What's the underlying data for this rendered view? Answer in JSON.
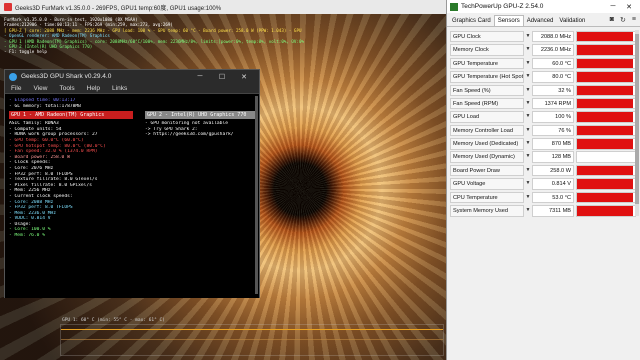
{
  "furmark": {
    "title": "Geeks3D FurMark v1.35.0.0 - 269FPS, GPU1 temp:60度, GPU1 usage:100%",
    "osd_lines": [
      {
        "text": "FurMark v1.35.0.0 - Burn-in test, 1920x1080 (8X MSAA)",
        "color": "#ffffff"
      },
      {
        "text": "Frames:212906 - time:00:13:11 - FPS:269 (min:259, max:273, avg:269)",
        "color": "#ffffff"
      },
      {
        "text": "[ GPU-Z ] core: 2088 MHz - mem: 2236 MHz - GPU load: 100 % - GPU temp: 60 °C - Board power: 258.0 W (PPW: 1.043) - GPU voltage: 0.814 V",
        "color": "#ffe14a"
      },
      {
        "text": "- OpenGL renderer: AMD Radeon(TM) Graphics",
        "color": "#7ee0ff"
      },
      {
        "text": "- GPU 1 (AMD Radeon(TM) Graphics) - core: 2088MHz/60°C/100%, mem: 2236MHz/8%, limits:[power:0%, temp:0%, volt:0%, OV:0%]",
        "color": "#7eff7e"
      },
      {
        "text": "- GPU 2 (Intel(R) UHD Graphics 770)",
        "color": "#7eff7e"
      },
      {
        "text": "- F1: toggle help",
        "color": "#ffffff"
      }
    ],
    "bottom_label": "GPU 1: 60° C (min: 55° C - max: 61° C)"
  },
  "gpushark": {
    "title": "Geeks3D GPU Shark v0.29.4.0",
    "menu": [
      "File",
      "View",
      "Tools",
      "Help",
      "Links"
    ],
    "left_top": [
      {
        "text": "- Elapsed time: 00:13:17",
        "color": "#7a7aff"
      },
      {
        "text": "- GL memory: total:17878MB",
        "color": "#ffffff"
      }
    ],
    "gpu1_header": "GPU 1 - AMD Radeon(TM) Graphics",
    "gpu1_lines": [
      {
        "text": "ASIC family: RDNA3",
        "color": "#ffffff"
      },
      {
        "text": "- Compute units: 54",
        "color": "#ffffff"
      },
      {
        "text": "- RDNA work group processors: 27",
        "color": "#ffffff"
      },
      {
        "text": "- GPU temp: 60.0°C (60.0°C)",
        "color": "#ff5050"
      },
      {
        "text": "- GPU hotspot temp: 80.0°C (80.0°C)",
        "color": "#ff5050"
      },
      {
        "text": "- Fan speed: 32.0 % (1374.0 RPM)",
        "color": "#ff5050"
      },
      {
        "text": "- Board power: 258.0 W",
        "color": "#ff9a9a"
      },
      {
        "text": "- Clock speeds:",
        "color": "#ffffff"
      },
      {
        "text": "  - Core: 2076 MHz",
        "color": "#ffffff"
      },
      {
        "text": "  - FP32 perf: 8.0 TFLOPS",
        "color": "#ffffff"
      },
      {
        "text": "  - Texture fillrate: 8.0 GTexel/s",
        "color": "#ffffff"
      },
      {
        "text": "  - Pixel fillrate: 8.0 GPixel/s",
        "color": "#ffffff"
      },
      {
        "text": "  - Mem: 2256 MHz",
        "color": "#ffffff"
      },
      {
        "text": "- Current clock speeds:",
        "color": "#ffffff"
      },
      {
        "text": "  - Core: 2088 MHz",
        "color": "#7ee0ff"
      },
      {
        "text": "  - FP32 perf: 8.0 TFLOPS",
        "color": "#7ee0ff"
      },
      {
        "text": "  - Mem: 2236.0 MHz",
        "color": "#7ee0ff"
      },
      {
        "text": "  - VDDC: 0.814 V",
        "color": "#7ee0ff"
      },
      {
        "text": "- Usage:",
        "color": "#ffffff"
      },
      {
        "text": "  - Core: 100.0 %",
        "color": "#7eff7e"
      },
      {
        "text": "  - Mem: 76.0 %",
        "color": "#7eff7e"
      }
    ],
    "gpu2_header": "GPU 2 - Intel(R) UHD Graphics 770",
    "gpu2_lines": [
      {
        "text": "- GPU monitoring not available",
        "color": "#ffffff"
      },
      {
        "text": "  -> Try GPU Shark 2:",
        "color": "#ffffff"
      },
      {
        "text": "  -> https://geeks3d.com/gpushark/",
        "color": "#ffffff"
      }
    ]
  },
  "gpuz": {
    "title": "TechPowerUp GPU-Z 2.54.0",
    "tabs": [
      "Graphics Card",
      "Sensors",
      "Advanced",
      "Validation"
    ],
    "active_tab": "Sensors",
    "accent": "#e01010",
    "sensors": [
      {
        "label": "GPU Clock",
        "value": "2088.0 MHz",
        "fill": 0.97
      },
      {
        "label": "Memory Clock",
        "value": "2236.0 MHz",
        "fill": 0.97
      },
      {
        "label": "GPU Temperature",
        "value": "60.0 °C",
        "fill": 0.97
      },
      {
        "label": "GPU Temperature (Hot Spot)",
        "value": "80.0 °C",
        "fill": 0.97
      },
      {
        "label": "Fan Speed (%)",
        "value": "32 %",
        "fill": 0.97
      },
      {
        "label": "Fan Speed (RPM)",
        "value": "1374 RPM",
        "fill": 0.97
      },
      {
        "label": "GPU Load",
        "value": "100 %",
        "fill": 0.97
      },
      {
        "label": "Memory Controller Load",
        "value": "76 %",
        "fill": 0.97
      },
      {
        "label": "Memory Used (Dedicated)",
        "value": "870 MB",
        "fill": 0.97
      },
      {
        "label": "Memory Used (Dynamic)",
        "value": "128 MB",
        "fill": 0.0
      },
      {
        "label": "Board Power Draw",
        "value": "258.0 W",
        "fill": 0.97
      },
      {
        "label": "GPU Voltage",
        "value": "0.814 V",
        "fill": 0.97
      },
      {
        "label": "CPU Temperature",
        "value": "53.0 °C",
        "fill": 0.97
      },
      {
        "label": "System Memory Used",
        "value": "7311 MB",
        "fill": 0.97
      }
    ]
  }
}
